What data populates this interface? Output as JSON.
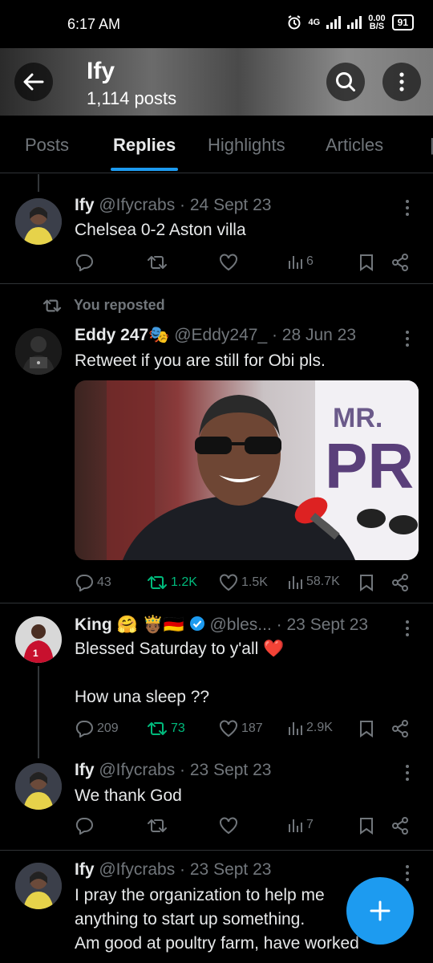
{
  "status_bar": {
    "time": "6:17 AM",
    "net_type": "4G",
    "net_speed_top": "0.00",
    "net_speed_bottom": "B/S",
    "battery": "91"
  },
  "header": {
    "name": "Ify",
    "post_count": "1,114 posts"
  },
  "tabs": [
    "Posts",
    "Replies",
    "Highlights",
    "Articles"
  ],
  "posts": [
    {
      "name": "Ify",
      "handle": "@Ifycrabs",
      "date": "· 24 Sept 23",
      "text": "Chelsea 0-2 Aston villa",
      "views": "6"
    },
    {
      "repost_label": "You reposted",
      "name": "Eddy 247🎭",
      "handle": "@Eddy247_",
      "date": "· 28 Jun 23",
      "text": "Retweet if you are still for Obi pls.",
      "image_text_1": "MR.",
      "image_text_2": "PR",
      "replies": "43",
      "reposts": "1.2K",
      "likes": "1.5K",
      "views": "58.7K"
    },
    {
      "name": "King 🤗 🤴🏾🇩🇪",
      "handle": "@bles...",
      "date": "· 23 Sept 23",
      "text": "Blessed Saturday to y'all ❤️\n\nHow una sleep ??",
      "replies": "209",
      "reposts": "73",
      "likes": "187",
      "views": "2.9K"
    },
    {
      "name": "Ify",
      "handle": "@Ifycrabs",
      "date": "· 23 Sept 23",
      "text": "We thank God",
      "views": "7"
    },
    {
      "name": "Ify",
      "handle": "@Ifycrabs",
      "date": "· 23 Sept 23",
      "text": "I pray the organization to help me\nanything to start up something.\nAm good at poultry farm, have worked"
    }
  ],
  "colors": {
    "accent": "#1d9bf0",
    "repost_active": "#00ba7c",
    "muted": "#71767b"
  }
}
